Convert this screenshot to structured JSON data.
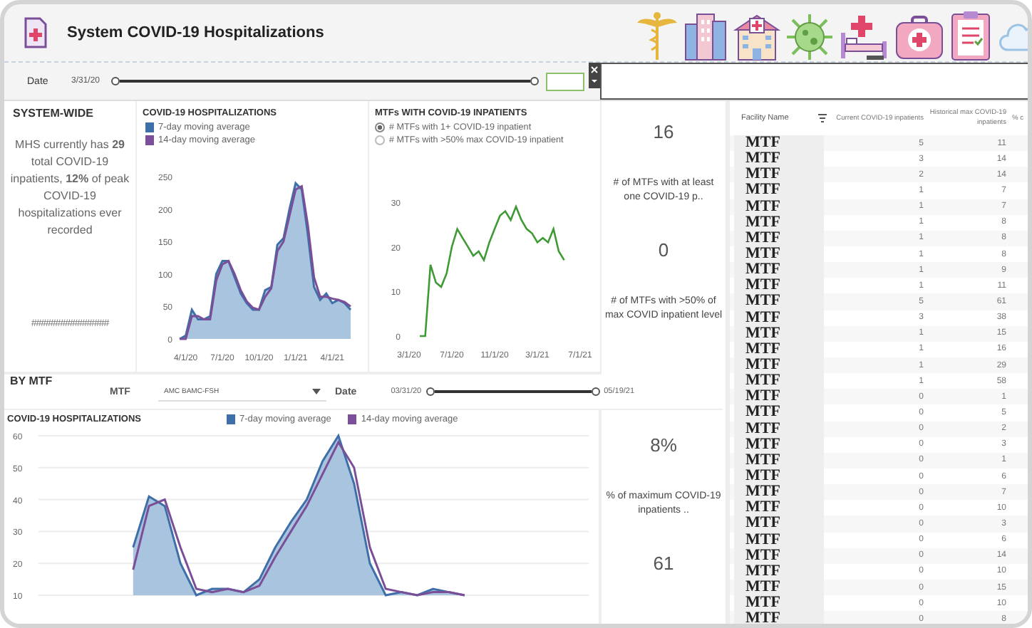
{
  "header": {
    "title": "System COVID-19 Hospitalizations"
  },
  "date_filter": {
    "label": "Date",
    "start": "3/31/20",
    "slider": {
      "level": 1
    }
  },
  "system_wide": {
    "heading": "SYSTEM-WIDE",
    "summary": "MHS currently has **29** total COVID-19 inpatients, **12%** of peak COVID-19 hospitalizations ever recorded",
    "overflow": "################"
  },
  "hospitalizations_chart": {
    "title": "COVID-19 HOSPITALIZATIONS",
    "chart_data": {
      "type": "line",
      "categories": [
        null,
        "4/1/20",
        null,
        null,
        null,
        null,
        null,
        "7/1/20",
        null,
        null,
        null,
        null,
        null,
        "10/1/20",
        null,
        null,
        null,
        null,
        null,
        "1/1/21",
        null,
        null,
        null,
        null,
        null,
        "4/1/21",
        null,
        null,
        null
      ],
      "ylim": [
        0,
        250
      ],
      "yticks": [
        0,
        50,
        100,
        150,
        200,
        250
      ],
      "series": [
        {
          "name": "7-day moving average",
          "color": "#3f6fa8",
          "values": [
            0,
            5,
            45,
            30,
            30,
            35,
            100,
            120,
            120,
            95,
            70,
            55,
            45,
            45,
            75,
            80,
            145,
            155,
            200,
            240,
            230,
            160,
            80,
            60,
            70,
            55,
            60,
            55,
            45
          ]
        },
        {
          "name": "14-day moving average",
          "color": "#7a4f98",
          "values": [
            0,
            0,
            35,
            35,
            30,
            30,
            90,
            115,
            120,
            100,
            75,
            58,
            48,
            45,
            65,
            78,
            135,
            150,
            190,
            230,
            235,
            175,
            95,
            65,
            65,
            62,
            60,
            57,
            50
          ]
        }
      ]
    }
  },
  "mtf_chart": {
    "title": "MTFs WITH COVID-19 INPATIENTS",
    "options": [
      {
        "label": "# MTFs with 1+ COVID-19 inpatient",
        "selected": true
      },
      {
        "label": "# MTFs with >50% max COVID-19 inpatient",
        "selected": false
      }
    ],
    "chart_data": {
      "type": "line",
      "categories": [
        "3/1/20",
        null,
        null,
        null,
        null,
        null,
        null,
        null,
        "7/1/20",
        null,
        null,
        null,
        null,
        null,
        null,
        null,
        "11/1/20",
        null,
        null,
        null,
        null,
        null,
        null,
        null,
        "3/1/21",
        null,
        null,
        null,
        null,
        null,
        null,
        null,
        "7/1/21"
      ],
      "ylim": [
        0,
        30
      ],
      "yticks": [
        0,
        10,
        20,
        30
      ],
      "series": [
        {
          "color": "#3f9a35",
          "values": [
            null,
            null,
            0,
            0,
            16,
            12,
            11,
            14,
            20,
            24,
            22,
            20,
            18,
            19,
            17,
            21,
            24,
            27,
            28,
            26,
            29,
            26,
            24,
            23,
            21,
            22,
            21,
            24,
            19,
            17,
            null,
            null,
            null
          ]
        }
      ]
    }
  },
  "kpis_top": [
    {
      "value": "16",
      "label": "# of MTFs with at least one COVID-19 p.."
    },
    {
      "value": "0",
      "label": "# of MTFs with >50% of max COVID inpatient level"
    }
  ],
  "by_mtf": {
    "heading": "BY MTF",
    "mtf_label": "MTF",
    "mtf_value": "AMC BAMC-FSH",
    "date_label": "Date",
    "start": "03/31/20",
    "end": "05/19/21",
    "slider": {
      "level": 1
    }
  },
  "mtf_hospitalizations_chart": {
    "title": "COVID-19 HOSPITALIZATIONS",
    "chart_data": {
      "type": "line",
      "grid": true,
      "categories": [
        null,
        null,
        null,
        null,
        null,
        null,
        null,
        null,
        null,
        null,
        null,
        null,
        null,
        null,
        null,
        null,
        null,
        null,
        null,
        null,
        null,
        null,
        null,
        null,
        null,
        null,
        null,
        null,
        null
      ],
      "ylim": [
        10,
        60
      ],
      "yticks": [
        10,
        20,
        30,
        40,
        50,
        60
      ],
      "series": [
        {
          "name": "7-day moving average",
          "color": "#3f6fa8",
          "values": [
            null,
            null,
            null,
            null,
            null,
            null,
            25,
            41,
            38,
            20,
            10,
            12,
            12,
            11,
            15,
            25,
            33,
            40,
            52,
            60,
            45,
            20,
            10,
            11,
            10,
            12,
            11,
            10,
            null
          ]
        },
        {
          "name": "14-day moving average",
          "color": "#7a4f98",
          "values": [
            null,
            null,
            null,
            null,
            null,
            null,
            18,
            38,
            40,
            25,
            12,
            11,
            12,
            11,
            13,
            22,
            30,
            38,
            48,
            58,
            50,
            25,
            12,
            11,
            10,
            11,
            11,
            10,
            null
          ]
        }
      ]
    }
  },
  "kpis_bottom": [
    {
      "value": "8%",
      "label": "% of maximum COVID-19 inpatients .."
    },
    {
      "value": "61"
    }
  ],
  "table": {
    "columns": [
      "Facility Name",
      "Current COVID-19 inpatients",
      "Historical max COVID-19 inpatients",
      "% c"
    ],
    "rows": [
      [
        "MTF",
        "5",
        "11"
      ],
      [
        "MTF",
        "3",
        "14"
      ],
      [
        "MTF",
        "2",
        "14"
      ],
      [
        "MTF",
        "1",
        "7"
      ],
      [
        "MTF",
        "1",
        "7"
      ],
      [
        "MTF",
        "1",
        "8"
      ],
      [
        "MTF",
        "1",
        "8"
      ],
      [
        "MTF",
        "1",
        "8"
      ],
      [
        "MTF",
        "1",
        "9"
      ],
      [
        "MTF",
        "1",
        "11"
      ],
      [
        "MTF",
        "5",
        "61"
      ],
      [
        "MTF",
        "3",
        "38"
      ],
      [
        "MTF",
        "1",
        "15"
      ],
      [
        "MTF",
        "1",
        "16"
      ],
      [
        "MTF",
        "1",
        "29"
      ],
      [
        "MTF",
        "1",
        "58"
      ],
      [
        "MTF",
        "0",
        "1"
      ],
      [
        "MTF",
        "0",
        "5"
      ],
      [
        "MTF",
        "0",
        "2"
      ],
      [
        "MTF",
        "0",
        "3"
      ],
      [
        "MTF",
        "0",
        "1"
      ],
      [
        "MTF",
        "0",
        "6"
      ],
      [
        "MTF",
        "0",
        "7"
      ],
      [
        "MTF",
        "0",
        "10"
      ],
      [
        "MTF",
        "0",
        "3"
      ],
      [
        "MTF",
        "0",
        "6"
      ],
      [
        "MTF",
        "0",
        "14"
      ],
      [
        "MTF",
        "0",
        "10"
      ],
      [
        "MTF",
        "0",
        "15"
      ],
      [
        "MTF",
        "0",
        "10"
      ],
      [
        "MTF",
        "0",
        "8"
      ]
    ]
  }
}
